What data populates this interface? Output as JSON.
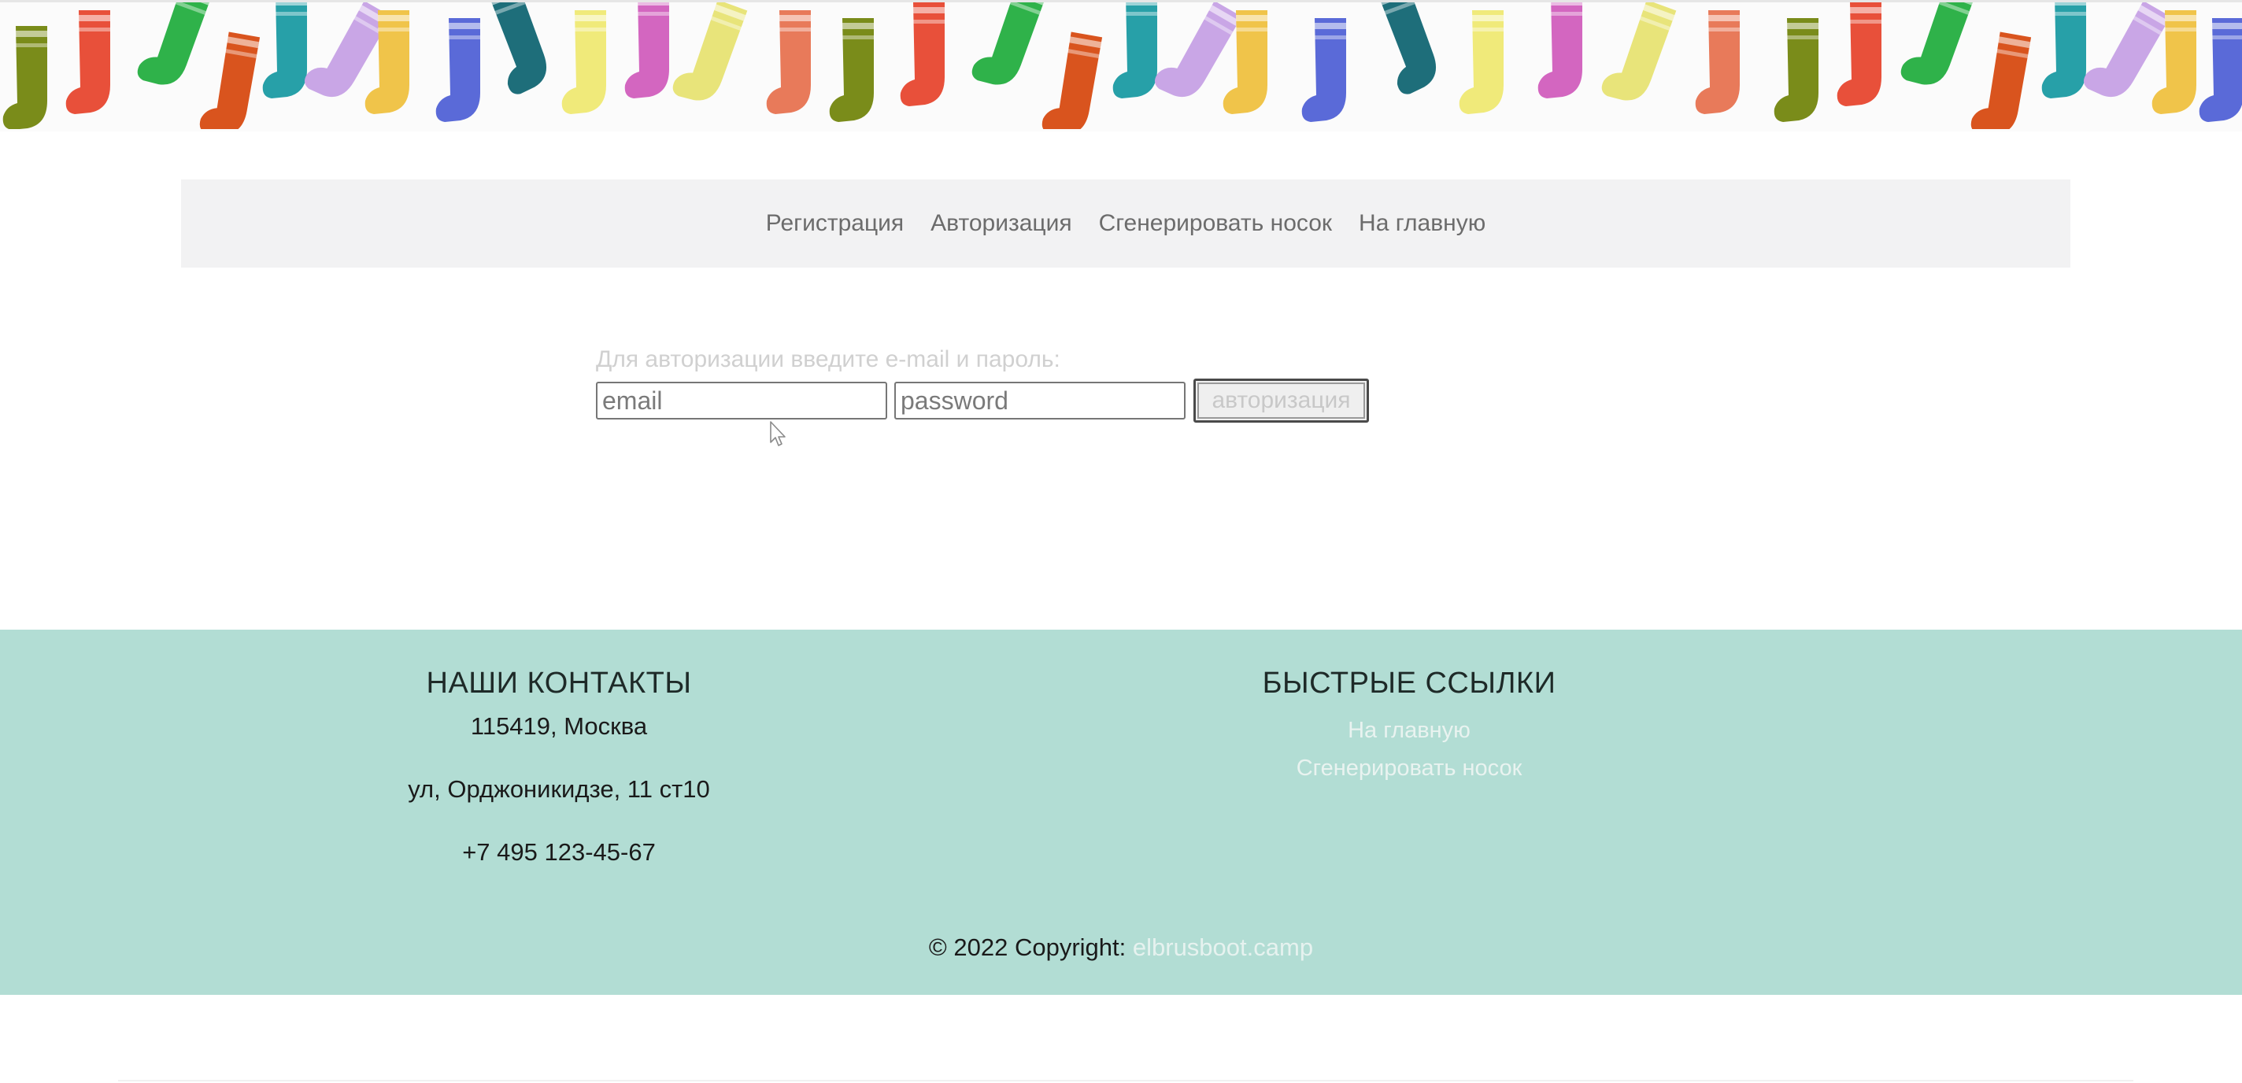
{
  "banner": {
    "image": "socks-pattern-banner"
  },
  "nav": {
    "items": [
      "Регистрация",
      "Авторизация",
      "Сгенерировать носок",
      "На главную"
    ]
  },
  "auth": {
    "hint": "Для авторизации введите e-mail и пароль:",
    "email_placeholder": "email",
    "password_placeholder": "password",
    "submit_label": "авторизация"
  },
  "footer": {
    "contacts_title": "НАШИ КОНТАКТЫ",
    "contacts": [
      "115419, Москва",
      "ул, Орджоникидзе, 11 ст10",
      "+7 495 123-45-67"
    ],
    "links_title": "БЫСТРЫЕ ССЫЛКИ",
    "links": [
      "На главную",
      "Сгенерировать носок"
    ],
    "copyright_prefix": "© 2022 Copyright:",
    "copyright_link": "elbrusboot.camp"
  },
  "colors": {
    "footer_bg": "#b2ddd4",
    "nav_bg": "#f2f2f3"
  }
}
